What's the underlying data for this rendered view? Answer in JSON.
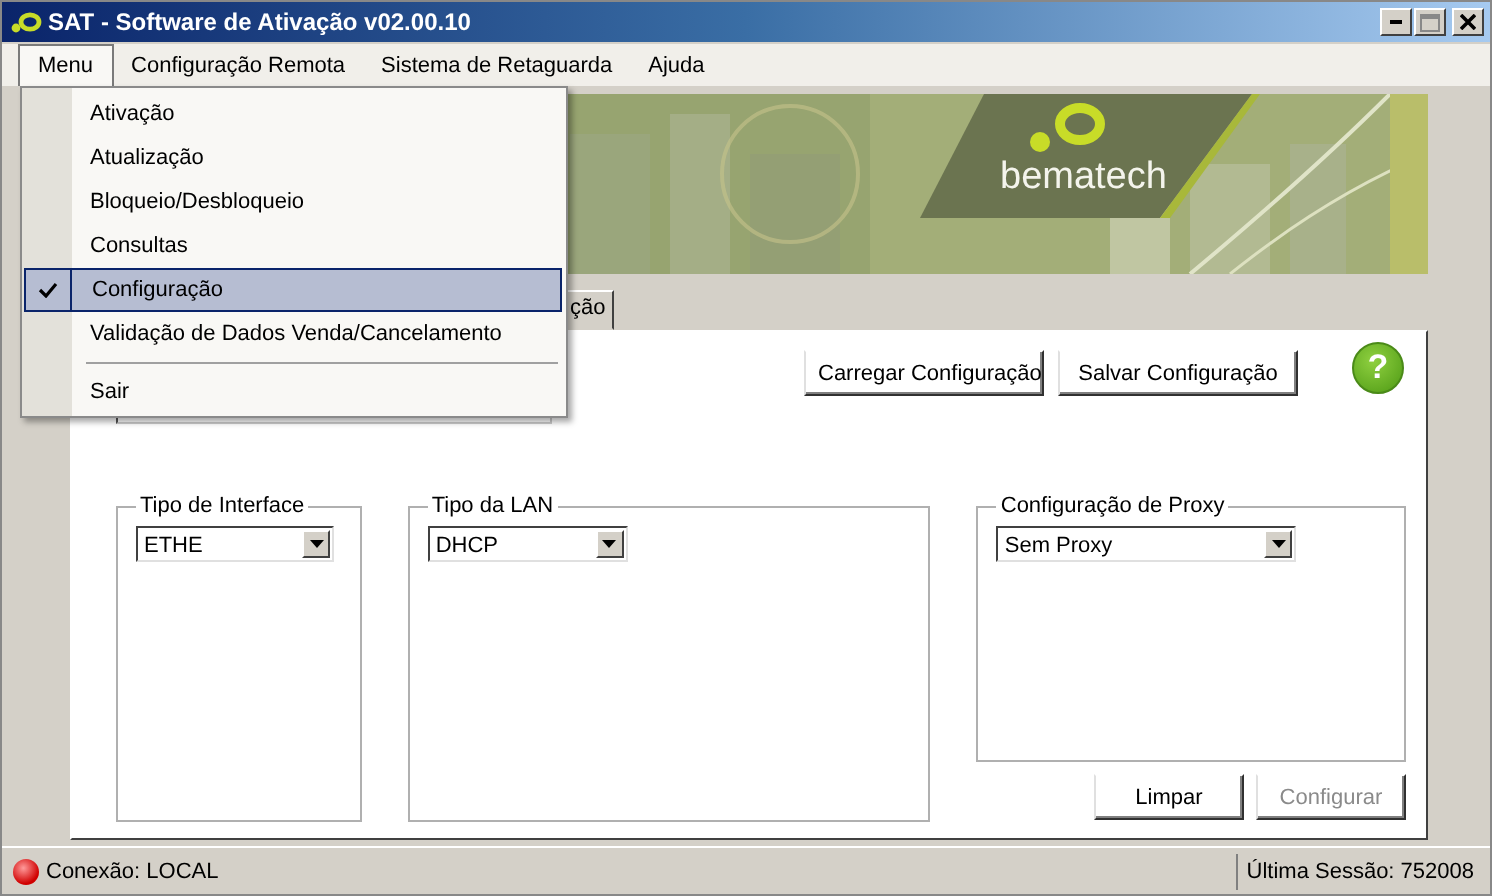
{
  "window": {
    "title": "SAT - Software de Ativação v02.00.10"
  },
  "menubar": [
    {
      "label": "Menu",
      "selected": true
    },
    {
      "label": "Configuração Remota",
      "selected": false
    },
    {
      "label": "Sistema de Retaguarda",
      "selected": false
    },
    {
      "label": "Ajuda",
      "selected": false
    }
  ],
  "menu": [
    {
      "kind": "item",
      "label": "Ativação",
      "checked": false,
      "selected": false
    },
    {
      "kind": "item",
      "label": "Atualização",
      "checked": false,
      "selected": false
    },
    {
      "kind": "item",
      "label": "Bloqueio/Desbloqueio",
      "checked": false,
      "selected": false
    },
    {
      "kind": "item",
      "label": "Consultas",
      "checked": false,
      "selected": false
    },
    {
      "kind": "item",
      "label": "Configuração",
      "checked": true,
      "selected": true
    },
    {
      "kind": "item",
      "label": "Validação de Dados Venda/Cancelamento",
      "checked": false,
      "selected": false
    },
    {
      "kind": "separator"
    },
    {
      "kind": "item",
      "label": "Sair",
      "checked": false,
      "selected": false
    }
  ],
  "banner": {
    "kind": "picture",
    "logo_text": "bematech"
  },
  "tabs": [
    {
      "label": "ção",
      "selected": true
    }
  ],
  "panel": {
    "help_label": "?",
    "top_buttons": [
      {
        "label": "Carregar Configuração",
        "disabled": false
      },
      {
        "label": "Salvar Configuração",
        "disabled": false
      }
    ],
    "groups": [
      {
        "title": "Tipo de Interface",
        "value": "ETHE"
      },
      {
        "title": "Tipo da LAN",
        "value": "DHCP"
      },
      {
        "title": "Configuração de Proxy",
        "value": "Sem Proxy"
      }
    ],
    "bottom_buttons": [
      {
        "label": "Limpar",
        "disabled": false
      },
      {
        "label": "Configurar",
        "disabled": true
      }
    ]
  },
  "status_bar": {
    "connection": "Conexão: LOCAL",
    "last_session": "Última Sessão: 752008"
  }
}
